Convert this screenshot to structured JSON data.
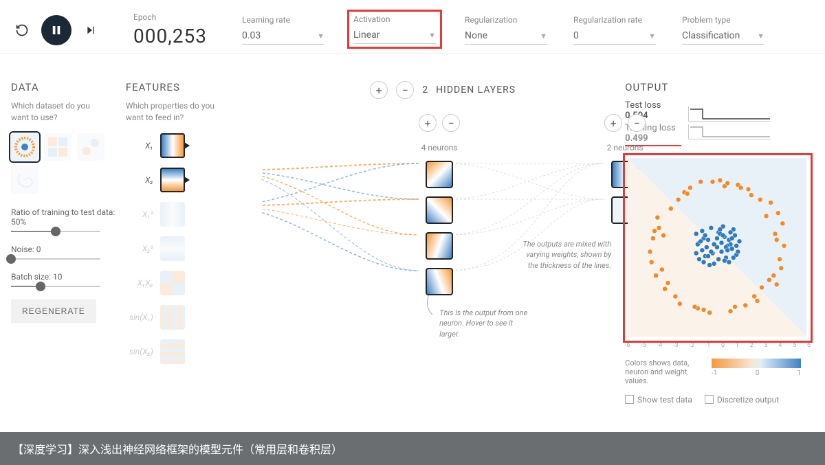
{
  "controls": {
    "epoch_label": "Epoch",
    "epoch_value": "000,253",
    "learning_rate_label": "Learning rate",
    "learning_rate_value": "0.03",
    "activation_label": "Activation",
    "activation_value": "Linear",
    "regularization_label": "Regularization",
    "regularization_value": "None",
    "regularization_rate_label": "Regularization rate",
    "regularization_rate_value": "0",
    "problem_type_label": "Problem type",
    "problem_type_value": "Classification"
  },
  "data": {
    "title": "DATA",
    "subtitle": "Which dataset do you want to use?",
    "datasets": [
      "circle",
      "xor",
      "gauss",
      "spiral"
    ],
    "selected_dataset_index": 0,
    "ratio_label": "Ratio of training to test data:  50%",
    "ratio_percent": 50,
    "noise_label": "Noise:  0",
    "noise_value": 0,
    "batch_label": "Batch size:  10",
    "batch_value": 10,
    "regenerate_label": "REGENERATE"
  },
  "features": {
    "title": "FEATURES",
    "subtitle": "Which properties do you want to feed in?",
    "items": [
      {
        "label": "X₁",
        "active": true
      },
      {
        "label": "X₂",
        "active": true
      },
      {
        "label": "X₁²",
        "active": false
      },
      {
        "label": "X₂²",
        "active": false
      },
      {
        "label": "X₁X₂",
        "active": false
      },
      {
        "label": "sin(X₁)",
        "active": false
      },
      {
        "label": "sin(X₂)",
        "active": false
      }
    ]
  },
  "network": {
    "hidden_layers_count": 2,
    "hidden_layers_label": "HIDDEN LAYERS",
    "layers": [
      {
        "neurons": 4,
        "label": "4 neurons"
      },
      {
        "neurons": 2,
        "label": "2 neurons"
      }
    ],
    "callout_neuron": "This is the output from one neuron. Hover to see it larger.",
    "callout_weights": "The outputs are mixed with varying weights, shown by the thickness of the lines."
  },
  "output": {
    "title": "OUTPUT",
    "test_loss_label": "Test loss",
    "test_loss_value": "0.504",
    "training_loss_label": "Training loss",
    "training_loss_value": "0.499",
    "axis_ticks": [
      "-6",
      "-5",
      "-4",
      "-3",
      "-2",
      "-1",
      "0",
      "1",
      "2",
      "3",
      "4",
      "5",
      "6"
    ],
    "colorbar_ticks": [
      "-1",
      "0",
      "1"
    ],
    "legend_text": "Colors shows data, neuron and weight values.",
    "show_test_label": "Show test data",
    "discretize_label": "Discretize output"
  },
  "chart_data": {
    "type": "scatter",
    "title": "",
    "xlabel": "",
    "ylabel": "",
    "xlim": [
      -6,
      6
    ],
    "ylim": [
      -6,
      6
    ],
    "series": [
      {
        "name": "class-blue",
        "color": "#2f7bbf",
        "points": [
          [
            -1.2,
            0.3
          ],
          [
            -0.8,
            -0.6
          ],
          [
            0.1,
            1.0
          ],
          [
            0.9,
            0.2
          ],
          [
            1.3,
            -0.5
          ],
          [
            -0.2,
            -1.1
          ],
          [
            0.5,
            0.7
          ],
          [
            -1.4,
            0.9
          ],
          [
            0.3,
            -0.3
          ],
          [
            1.1,
            1.2
          ],
          [
            -0.6,
            0.5
          ],
          [
            0.8,
            -1.0
          ],
          [
            -1.0,
            -0.2
          ],
          [
            0.0,
            0.0
          ],
          [
            1.5,
            0.4
          ],
          [
            -0.4,
            1.3
          ],
          [
            0.6,
            -0.7
          ],
          [
            -1.2,
            -0.8
          ],
          [
            0.2,
            0.9
          ],
          [
            1.0,
            -0.1
          ],
          [
            -0.7,
            0.0
          ],
          [
            0.4,
            1.4
          ],
          [
            -0.9,
            0.6
          ],
          [
            1.2,
            0.8
          ],
          [
            -0.3,
            -0.4
          ],
          [
            0.7,
            0.1
          ],
          [
            -1.3,
            0.2
          ],
          [
            0.9,
            1.0
          ],
          [
            -0.5,
            -1.2
          ],
          [
            0.0,
            0.6
          ],
          [
            1.4,
            -0.3
          ],
          [
            -0.8,
            0.8
          ],
          [
            0.3,
            0.3
          ],
          [
            1.1,
            -0.7
          ],
          [
            -1.1,
            0.4
          ],
          [
            0.5,
            -0.9
          ],
          [
            -0.2,
            0.2
          ],
          [
            0.8,
            0.5
          ],
          [
            -0.6,
            -0.6
          ],
          [
            1.3,
            0.1
          ],
          [
            -1.0,
            1.1
          ],
          [
            0.1,
            -0.8
          ],
          [
            0.6,
            0.0
          ],
          [
            -0.4,
            -0.3
          ],
          [
            1.0,
            0.6
          ],
          [
            -0.9,
            -1.0
          ],
          [
            0.2,
            1.2
          ],
          [
            -1.4,
            -0.4
          ],
          [
            0.7,
            -0.2
          ],
          [
            0.4,
            0.8
          ]
        ]
      },
      {
        "name": "class-orange",
        "color": "#f08a2a",
        "points": [
          [
            -4.2,
            1.1
          ],
          [
            -3.5,
            -2.8
          ],
          [
            4.0,
            0.5
          ],
          [
            2.9,
            3.2
          ],
          [
            -1.3,
            -4.1
          ],
          [
            3.8,
            -1.9
          ],
          [
            -4.5,
            -0.3
          ],
          [
            0.7,
            4.3
          ],
          [
            -2.2,
            3.7
          ],
          [
            4.4,
            1.6
          ],
          [
            1.9,
            -3.9
          ],
          [
            -3.1,
            2.6
          ],
          [
            -0.5,
            -4.4
          ],
          [
            3.3,
            2.1
          ],
          [
            -4.0,
            2.0
          ],
          [
            2.5,
            -3.3
          ],
          [
            -2.8,
            -3.3
          ],
          [
            4.2,
            -0.8
          ],
          [
            0.2,
            4.5
          ],
          [
            -3.7,
            -1.5
          ],
          [
            3.6,
            3.0
          ],
          [
            -1.8,
            4.0
          ],
          [
            4.5,
            0.1
          ],
          [
            -0.9,
            -4.2
          ],
          [
            2.1,
            3.9
          ],
          [
            -4.3,
            0.6
          ],
          [
            3.0,
            -2.7
          ],
          [
            -2.5,
            -3.8
          ],
          [
            1.4,
            4.2
          ],
          [
            -3.9,
            1.3
          ],
          [
            4.1,
            2.3
          ],
          [
            -1.1,
            4.4
          ],
          [
            2.7,
            -3.6
          ],
          [
            -4.4,
            -1.0
          ],
          [
            0.9,
            -4.3
          ],
          [
            3.5,
            -2.2
          ],
          [
            -2.0,
            3.6
          ],
          [
            -3.3,
            -2.4
          ],
          [
            4.3,
            -1.4
          ],
          [
            1.6,
            4.0
          ],
          [
            -4.1,
            -1.9
          ],
          [
            2.3,
            3.5
          ],
          [
            -0.3,
            4.4
          ],
          [
            3.9,
            0.9
          ],
          [
            -2.6,
            3.2
          ],
          [
            -3.6,
            0.8
          ],
          [
            1.2,
            -4.0
          ],
          [
            4.0,
            -2.5
          ],
          [
            -1.5,
            -4.0
          ],
          [
            0.5,
            4.1
          ]
        ]
      }
    ],
    "decision_boundary": "diagonal-light"
  },
  "caption": "【深度学习】深入浅出神经网络框架的模型元件（常用层和卷积层）"
}
